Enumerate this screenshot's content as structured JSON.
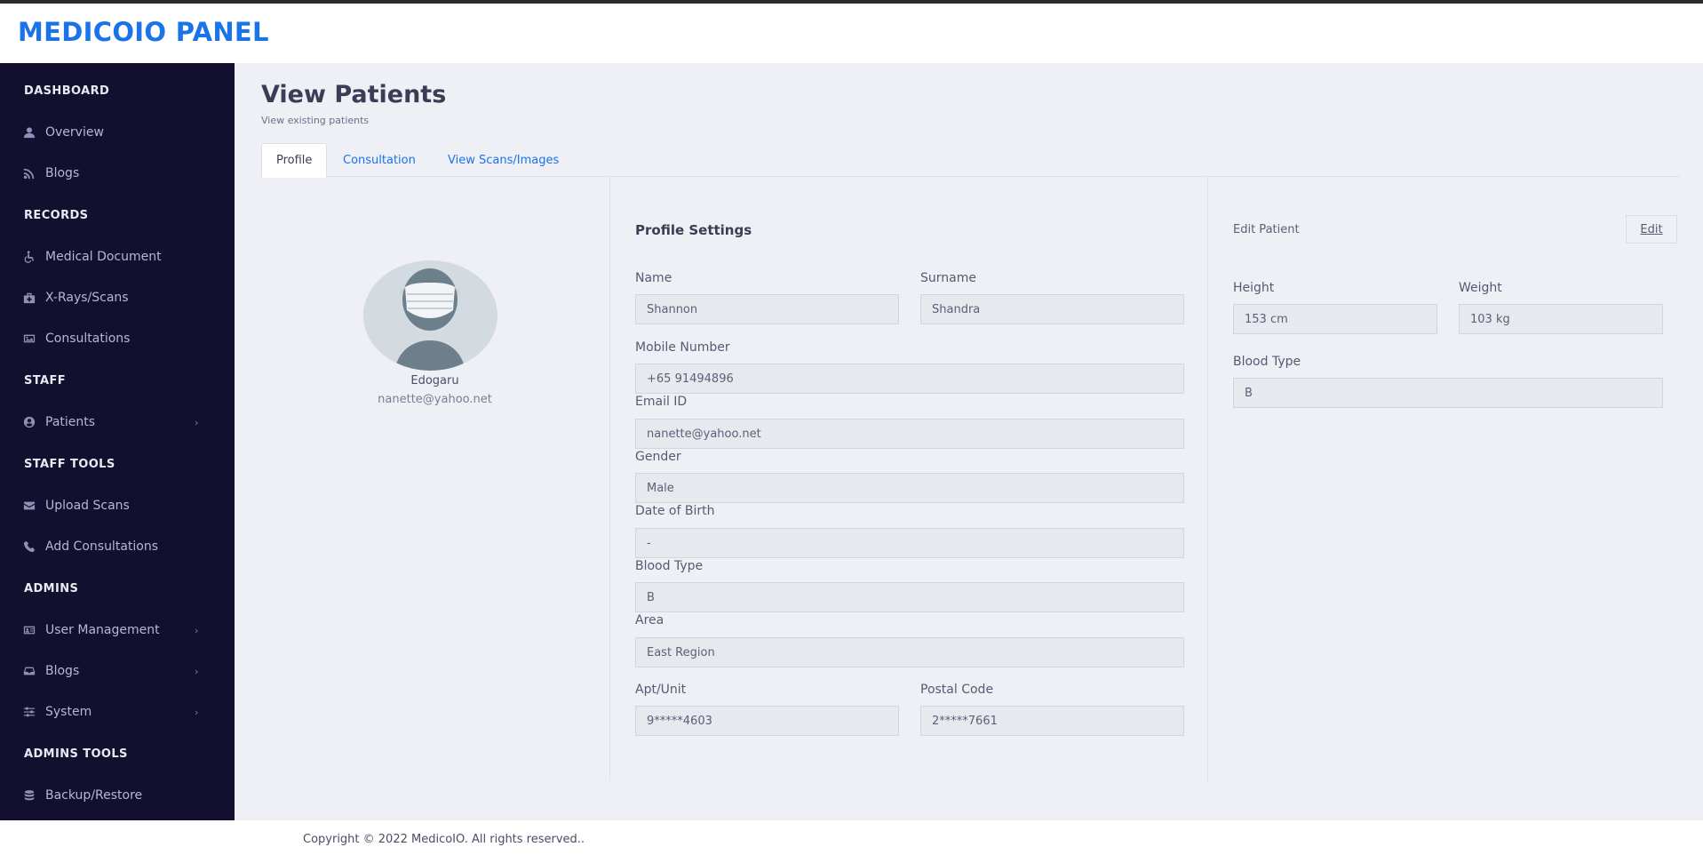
{
  "header": {
    "brand": "MEDICOIO PANEL"
  },
  "sidebar": {
    "sections": [
      {
        "title": "DASHBOARD"
      },
      {
        "title": "RECORDS"
      },
      {
        "title": "STAFF"
      },
      {
        "title": "STAFF TOOLS"
      },
      {
        "title": "ADMINS"
      },
      {
        "title": "ADMINS TOOLS"
      }
    ],
    "items": [
      {
        "label": "Overview",
        "icon": "user-icon"
      },
      {
        "label": "Blogs",
        "icon": "rss-icon"
      },
      {
        "label": "Medical Document",
        "icon": "wheelchair-icon"
      },
      {
        "label": "X-Rays/Scans",
        "icon": "medkit-icon"
      },
      {
        "label": "Consultations",
        "icon": "image-icon"
      },
      {
        "label": "Patients",
        "icon": "user-circle-icon",
        "has_submenu": true
      },
      {
        "label": "Upload Scans",
        "icon": "envelope-icon"
      },
      {
        "label": "Add Consultations",
        "icon": "phone-icon"
      },
      {
        "label": "User Management",
        "icon": "id-card-icon",
        "has_submenu": true
      },
      {
        "label": "Blogs",
        "icon": "inbox-icon",
        "has_submenu": true
      },
      {
        "label": "System",
        "icon": "sliders-icon",
        "has_submenu": true
      },
      {
        "label": "Backup/Restore",
        "icon": "database-icon"
      }
    ]
  },
  "page": {
    "title": "View Patients",
    "subtitle": "View existing patients"
  },
  "tabs": [
    {
      "label": "Profile",
      "active": true
    },
    {
      "label": "Consultation",
      "active": false
    },
    {
      "label": "View Scans/Images",
      "active": false
    }
  ],
  "profile_card": {
    "name": "Edogaru",
    "email": "nanette@yahoo.net"
  },
  "profile_settings": {
    "title": "Profile Settings",
    "name": {
      "label": "Name",
      "value": "Shannon"
    },
    "surname": {
      "label": "Surname",
      "value": "Shandra"
    },
    "mobile": {
      "label": "Mobile Number",
      "value": "+65 91494896"
    },
    "email": {
      "label": "Email ID",
      "value": "nanette@yahoo.net"
    },
    "gender": {
      "label": "Gender",
      "value": "Male"
    },
    "dob": {
      "label": "Date of Birth",
      "value": "-"
    },
    "blood_type": {
      "label": "Blood Type",
      "value": "B"
    },
    "area": {
      "label": "Area",
      "value": "East Region"
    },
    "apt": {
      "label": "Apt/Unit",
      "value": "9*****4603"
    },
    "postal": {
      "label": "Postal Code",
      "value": "2*****7661"
    }
  },
  "edit_patient": {
    "title": "Edit Patient",
    "edit_label": "Edit",
    "height": {
      "label": "Height",
      "value": "153 cm"
    },
    "weight": {
      "label": "Weight",
      "value": "103 kg"
    },
    "blood_type": {
      "label": "Blood Type",
      "value": "B"
    }
  },
  "footer": {
    "copyright": "Copyright © 2022 MedicoIO. All rights reserved.."
  },
  "colors": {
    "brand": "#1a73e8",
    "sidebar_bg": "#12102e",
    "page_bg": "#eef0f5"
  }
}
